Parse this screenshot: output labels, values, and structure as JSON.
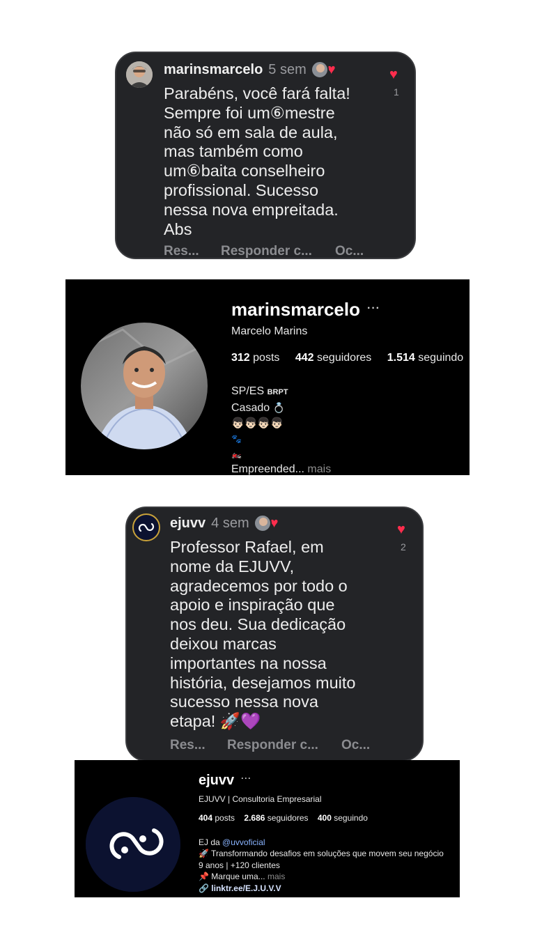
{
  "comment1": {
    "username": "marinsmarcelo",
    "time": "5 sem",
    "lines": [
      "Parabéns, você fará falta!",
      "Sempre foi um⑥mestre",
      "não só em sala de aula,",
      "mas também como",
      "um⑥baita conselheiro",
      "profissional. Sucesso",
      "nessa nova empreitada.",
      "Abs"
    ],
    "like_count": "1",
    "actions": [
      "Res...",
      "Responder c...",
      "Oc..."
    ]
  },
  "profile1": {
    "username": "marinsmarcelo",
    "more": "···",
    "full_name": "Marcelo Marins",
    "posts_count": "312",
    "posts_label": "posts",
    "followers_count": "442",
    "followers_label": "seguidores",
    "following_count": "1.514",
    "following_label": "seguindo",
    "bio_location": "SP/ES",
    "bio_flags": "BRPT",
    "bio_status": "Casado",
    "bio_status_emoji": "💍",
    "bio_emoji_row": "👦🏻👦🏻👦🏻👦🏻",
    "bio_paws": "🐾",
    "bio_bike": "🏍️",
    "bio_more_text": "Empreended...",
    "bio_more_link": "mais"
  },
  "comment2": {
    "username": "ejuvv",
    "time": "4 sem",
    "lines": [
      "Professor Rafael, em",
      "nome da EJUVV,",
      "agradecemos por todo o",
      "apoio e inspiração que",
      "nos deu. Sua dedicação",
      "deixou marcas",
      "importantes na nossa",
      "história, desejamos muito",
      "sucesso nessa nova",
      "etapa! 🚀💜"
    ],
    "like_count": "2",
    "actions": [
      "Res...",
      "Responder c...",
      "Oc..."
    ]
  },
  "profile2": {
    "username": "ejuvv",
    "more": "···",
    "full_name": "EJUVV | Consultoria Empresarial",
    "posts_count": "404",
    "posts_label": "posts",
    "followers_count": "2.686",
    "followers_label": "seguidores",
    "following_count": "400",
    "following_label": "seguindo",
    "bio_line1_prefix": "EJ da",
    "bio_line1_mention": "@uvvoficial",
    "bio_line2": "🚀 Transformando desafios em soluções que movem seu negócio",
    "bio_line3": "9 anos | +120 clientes",
    "bio_line4": "📌 Marque uma...",
    "bio_more_link": "mais",
    "bio_link_icon": "🔗",
    "bio_link": "linktr.ee/E.J.U.V.V"
  },
  "colors": {
    "card_bg": "#232427",
    "profile_bg": "#000000",
    "heart": "#ff2d4d",
    "link": "#8ab4ff",
    "muted": "#8e8e8e",
    "ejuvv_logo_bg": "#0c1230"
  }
}
